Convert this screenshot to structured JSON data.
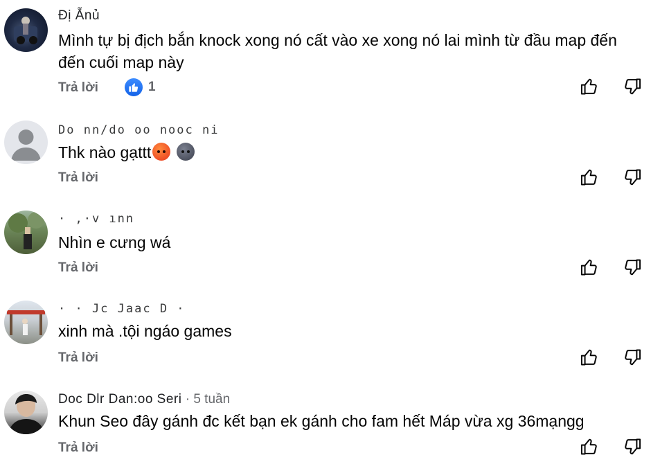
{
  "comments": [
    {
      "name": "Đị Ẫnủ",
      "meta": "",
      "text": "Mình tự bị địch bắn knock xong nó cất vào xe xong nó lai mình từ đầu map đến đến cuối map này",
      "reply": "Trả lời",
      "likes": "1",
      "avatar": "photo-dark"
    },
    {
      "name": "Do nn/do oo nooc ni",
      "meta": "",
      "text": "Thk nào gạttt",
      "emojis": [
        "angry-face",
        "new-moon-face"
      ],
      "reply": "Trả lời",
      "likes": "",
      "avatar": "default-person"
    },
    {
      "name": "· ,·v ınn",
      "meta": "",
      "text": "Nhìn e cưng wá",
      "reply": "Trả lời",
      "likes": "",
      "avatar": "photo-outdoor"
    },
    {
      "name": "· · Jc  Jaac  D  ·",
      "meta": "",
      "text": "xinh mà .tội ngáo games",
      "reply": "Trả lời",
      "likes": "",
      "avatar": "photo-outdoor-2"
    },
    {
      "name": "Doc Dlr  Dan:oo Seri",
      "meta": " · 5 tuần",
      "text": "Khun Seo đây gánh đc kết bạn ek gánh cho fam hết Máp vừa xg 36mạngg",
      "reply": "Trả lời",
      "likes": "",
      "avatar": "photo-portrait"
    }
  ],
  "icons": {
    "like": "thumbs-up-icon",
    "dislike": "thumbs-down-icon",
    "like_badge": "like-badge-icon"
  },
  "colors": {
    "secondary_text": "#65676b",
    "like_blue": "#1877f2"
  }
}
